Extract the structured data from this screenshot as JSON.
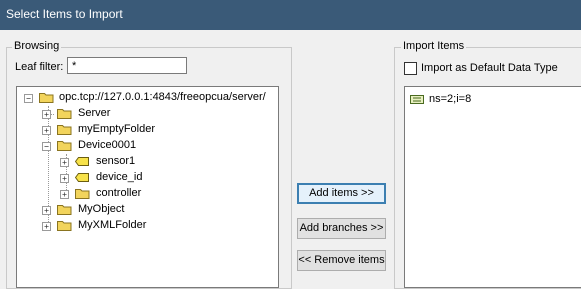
{
  "window": {
    "title": "Select Items to Import"
  },
  "browsing": {
    "group_label": "Browsing",
    "leaf_filter_label": "Leaf filter:",
    "leaf_filter_value": "*",
    "tree": {
      "root": "opc.tcp://127.0.0.1:4843/freeopcua/server/",
      "server": "Server",
      "my_empty_folder": "myEmptyFolder",
      "device": "Device0001",
      "sensor": "sensor1",
      "device_id": "device_id",
      "controller": "controller",
      "my_object": "MyObject",
      "my_xml_folder": "MyXMLFolder"
    }
  },
  "buttons": {
    "add_items": "Add items >>",
    "add_branches": "Add branches >>",
    "remove_items": "<< Remove items"
  },
  "import": {
    "group_label": "Import Items",
    "checkbox_label": "Import as Default Data Type",
    "items": [
      "ns=2;i=8"
    ]
  },
  "colors": {
    "folder": "#f2d45c",
    "titlebar": "#3a5a78",
    "selected_border": "#3c7fb1"
  },
  "icons": {
    "folder": "folder-icon",
    "variable": "variable-tag-icon",
    "item": "item-tag-icon"
  }
}
